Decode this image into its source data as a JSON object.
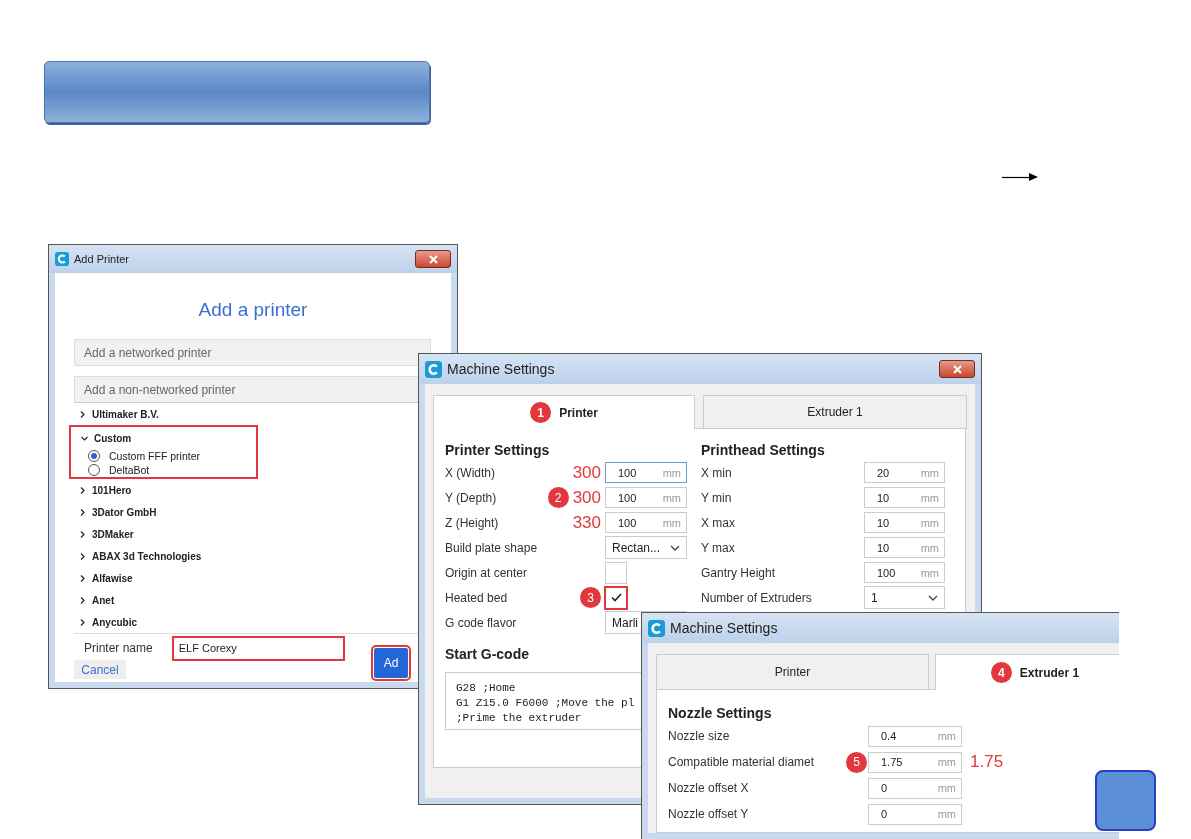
{
  "add_printer_dialog": {
    "title": "Add Printer",
    "heading": "Add a printer",
    "sections": [
      {
        "label": "Add a networked printer",
        "expanded": false
      },
      {
        "label": "Add a non-networked printer",
        "expanded": true
      }
    ],
    "printers": [
      {
        "name": "Ultimaker B.V.",
        "expanded": false,
        "highlighted": false
      },
      {
        "name": "Custom",
        "expanded": true,
        "highlighted": true,
        "children": [
          {
            "name": "Custom FFF printer",
            "selected": true
          },
          {
            "name": "DeltaBot",
            "selected": false
          }
        ]
      },
      {
        "name": "101Hero",
        "expanded": false,
        "highlighted": false
      },
      {
        "name": "3Dator GmbH",
        "expanded": false,
        "highlighted": false
      },
      {
        "name": "3DMaker",
        "expanded": false,
        "highlighted": false
      },
      {
        "name": "ABAX 3d Technologies",
        "expanded": false,
        "highlighted": false
      },
      {
        "name": "Alfawise",
        "expanded": false,
        "highlighted": false
      },
      {
        "name": "Anet",
        "expanded": false,
        "highlighted": false
      },
      {
        "name": "Anycubic",
        "expanded": false,
        "highlighted": false
      }
    ],
    "printer_name": {
      "label": "Printer name",
      "value": "ELF Corexy",
      "highlighted": true
    },
    "buttons": [
      {
        "label": "Cancel",
        "kind": "secondary",
        "highlighted": false
      },
      {
        "label": "Ad",
        "kind": "primary",
        "highlighted": true
      }
    ]
  },
  "machine_settings_printer": {
    "title": "Machine Settings",
    "tabs": [
      {
        "label": "Printer",
        "selected": true,
        "marker": "1"
      },
      {
        "label": "Extruder 1",
        "selected": false
      }
    ],
    "printer_settings": {
      "heading": "Printer Settings",
      "rows": [
        {
          "kind": "number",
          "label": "X (Width)",
          "value": "100",
          "unit": "mm",
          "note": "300",
          "focused": true
        },
        {
          "kind": "number",
          "label": "Y (Depth)",
          "value": "100",
          "unit": "mm",
          "note": "300",
          "marker": "2",
          "focused": false
        },
        {
          "kind": "number",
          "label": "Z (Height)",
          "value": "100",
          "unit": "mm",
          "note": "330",
          "focused": false
        },
        {
          "kind": "select",
          "label": "Build plate shape",
          "value": "Rectan..."
        },
        {
          "kind": "checkbox",
          "label": "Origin at center",
          "checked": false,
          "highlighted": false
        },
        {
          "kind": "checkbox",
          "label": "Heated bed",
          "checked": true,
          "marker": "3",
          "highlighted": true
        },
        {
          "kind": "select",
          "label": "G code flavor",
          "value": "Marli"
        }
      ]
    },
    "printhead_settings": {
      "heading": "Printhead Settings",
      "rows": [
        {
          "kind": "number",
          "label": "X min",
          "value": "20",
          "unit": "mm",
          "focused": false
        },
        {
          "kind": "number",
          "label": "Y min",
          "value": "10",
          "unit": "mm",
          "focused": false
        },
        {
          "kind": "number",
          "label": "X max",
          "value": "10",
          "unit": "mm",
          "focused": false
        },
        {
          "kind": "number",
          "label": "Y max",
          "value": "10",
          "unit": "mm",
          "focused": false
        },
        {
          "kind": "number",
          "label": "Gantry Height",
          "value": "100",
          "unit": "mm",
          "focused": false
        },
        {
          "kind": "select",
          "label": "Number of Extruders",
          "value": "1"
        }
      ]
    },
    "start_gcode": {
      "heading": "Start G-code",
      "lines": [
        "G28 ;Home",
        "G1 Z15.0 F6000 ;Move the pl",
        ";Prime the extruder"
      ]
    }
  },
  "machine_settings_extruder": {
    "title": "Machine Settings",
    "tabs": [
      {
        "label": "Printer",
        "selected": false
      },
      {
        "label": "Extruder 1",
        "selected": true,
        "marker": "4"
      }
    ],
    "nozzle_settings": {
      "heading": "Nozzle Settings",
      "rows": [
        {
          "kind": "number",
          "label": "Nozzle size",
          "value": "0.4",
          "unit": "mm",
          "focused": false
        },
        {
          "kind": "number",
          "label": "Compatible material diamet",
          "value": "1.75",
          "unit": "mm",
          "marker": "5",
          "note": "1.75",
          "focused": false
        },
        {
          "kind": "number",
          "label": "Nozzle offset X",
          "value": "0",
          "unit": "mm",
          "focused": false
        },
        {
          "kind": "number",
          "label": "Nozzle offset Y",
          "value": "0",
          "unit": "mm",
          "focused": false
        }
      ]
    }
  }
}
